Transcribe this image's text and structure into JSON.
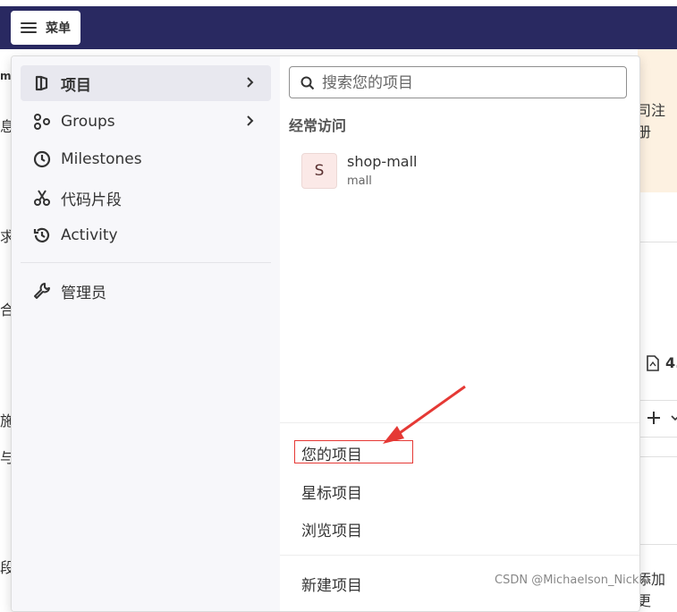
{
  "topbar": {
    "menu_label": "菜单"
  },
  "background": {
    "left_fragments": [
      "m",
      "息",
      "求",
      "合",
      "施",
      "与",
      "段"
    ],
    "right_banner_text": "司注册",
    "right_number": "4.",
    "right_bottom_text": "添加更"
  },
  "menu": {
    "left_items": [
      {
        "label": "项目",
        "icon": "project-icon",
        "has_chevron": true,
        "active": true
      },
      {
        "label": "Groups",
        "icon": "groups-icon",
        "has_chevron": true,
        "active": false
      },
      {
        "label": "Milestones",
        "icon": "clock-icon",
        "has_chevron": false,
        "active": false
      },
      {
        "label": "代码片段",
        "icon": "scissors-icon",
        "has_chevron": false,
        "active": false
      },
      {
        "label": "Activity",
        "icon": "history-icon",
        "has_chevron": false,
        "active": false
      }
    ],
    "admin_item": {
      "label": "管理员",
      "icon": "wrench-icon"
    },
    "search": {
      "placeholder": "搜索您的项目"
    },
    "frequent_title": "经常访问",
    "frequent_projects": [
      {
        "avatar_letter": "S",
        "name": "shop-mall",
        "namespace": "mall"
      }
    ],
    "links": [
      "您的项目",
      "星标项目",
      "浏览项目"
    ],
    "new_project": "新建项目"
  },
  "watermark": "CSDN @Michaelson_Nickle",
  "colors": {
    "nav_bg": "#292961",
    "annotation": "#e53935",
    "banner": "#fdf1e1"
  }
}
